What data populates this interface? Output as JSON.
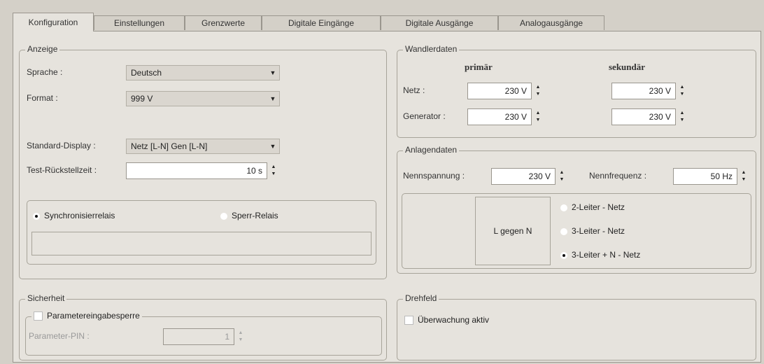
{
  "tabs": [
    {
      "label": "Konfiguration",
      "active": true
    },
    {
      "label": "Einstellungen"
    },
    {
      "label": "Grenzwerte"
    },
    {
      "label": "Digitale Eingänge"
    },
    {
      "label": "Digitale Ausgänge"
    },
    {
      "label": "Analogausgänge"
    }
  ],
  "anzeige": {
    "title": "Anzeige",
    "sprache_label": "Sprache :",
    "sprache_value": "Deutsch",
    "format_label": "Format :",
    "format_value": "999 V",
    "standard_display_label": "Standard-Display :",
    "standard_display_value": "Netz [L-N] Gen [L-N]",
    "test_label": "Test-Rückstellzeit :",
    "test_value": "10 s",
    "radio_sync": "Synchronisierrelais",
    "radio_sperr": "Sperr-Relais"
  },
  "sicherheit": {
    "title": "Sicherheit",
    "checkbox_label": "Parametereingabesperre",
    "pin_label": "Parameter-PIN :",
    "pin_value": "1"
  },
  "wandlerdaten": {
    "title": "Wandlerdaten",
    "primaer": "primär",
    "sekundaer": "sekundär",
    "netz_label": "Netz :",
    "generator_label": "Generator :",
    "netz_primaer": "230 V",
    "netz_sekundaer": "230 V",
    "gen_primaer": "230 V",
    "gen_sekundaer": "230 V"
  },
  "anlagendaten": {
    "title": "Anlagendaten",
    "nennspannung_label": "Nennspannung :",
    "nennspannung_value": "230 V",
    "nennfrequenz_label": "Nennfrequenz :",
    "nennfrequenz_value": "50 Hz",
    "l_gegen_n": "L gegen N",
    "radio_2leiter": "2-Leiter - Netz",
    "radio_3leiter": "3-Leiter - Netz",
    "radio_3leiter_n": "3-Leiter + N - Netz"
  },
  "drehfeld": {
    "title": "Drehfeld",
    "checkbox_label": "Überwachung aktiv"
  }
}
